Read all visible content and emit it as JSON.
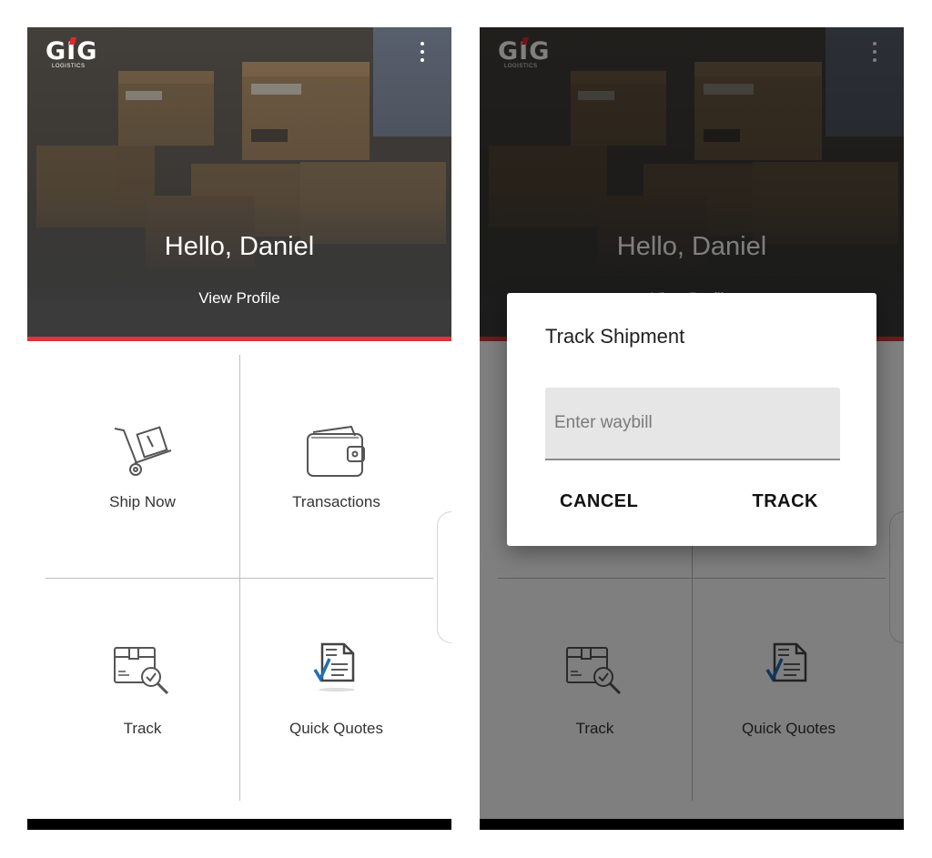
{
  "app": {
    "logo_text": "GIG",
    "logo_subtext": "LOGISTICS"
  },
  "header": {
    "greeting": "Hello, Daniel",
    "profile_link": "View Profile"
  },
  "tiles": [
    {
      "label": "Ship Now",
      "icon": "hand-truck-icon"
    },
    {
      "label": "Transactions",
      "icon": "wallet-icon"
    },
    {
      "label": "Track",
      "icon": "package-search-icon"
    },
    {
      "label": "Quick Quotes",
      "icon": "quote-document-icon"
    }
  ],
  "dialog": {
    "title": "Track Shipment",
    "input_placeholder": "Enter waybill",
    "input_value": "",
    "cancel_label": "CANCEL",
    "track_label": "TRACK"
  },
  "colors": {
    "accent": "#d9373b",
    "header_dark": "#3b3b3b",
    "text_dark": "#333333",
    "check_blue": "#1f6fb5"
  }
}
